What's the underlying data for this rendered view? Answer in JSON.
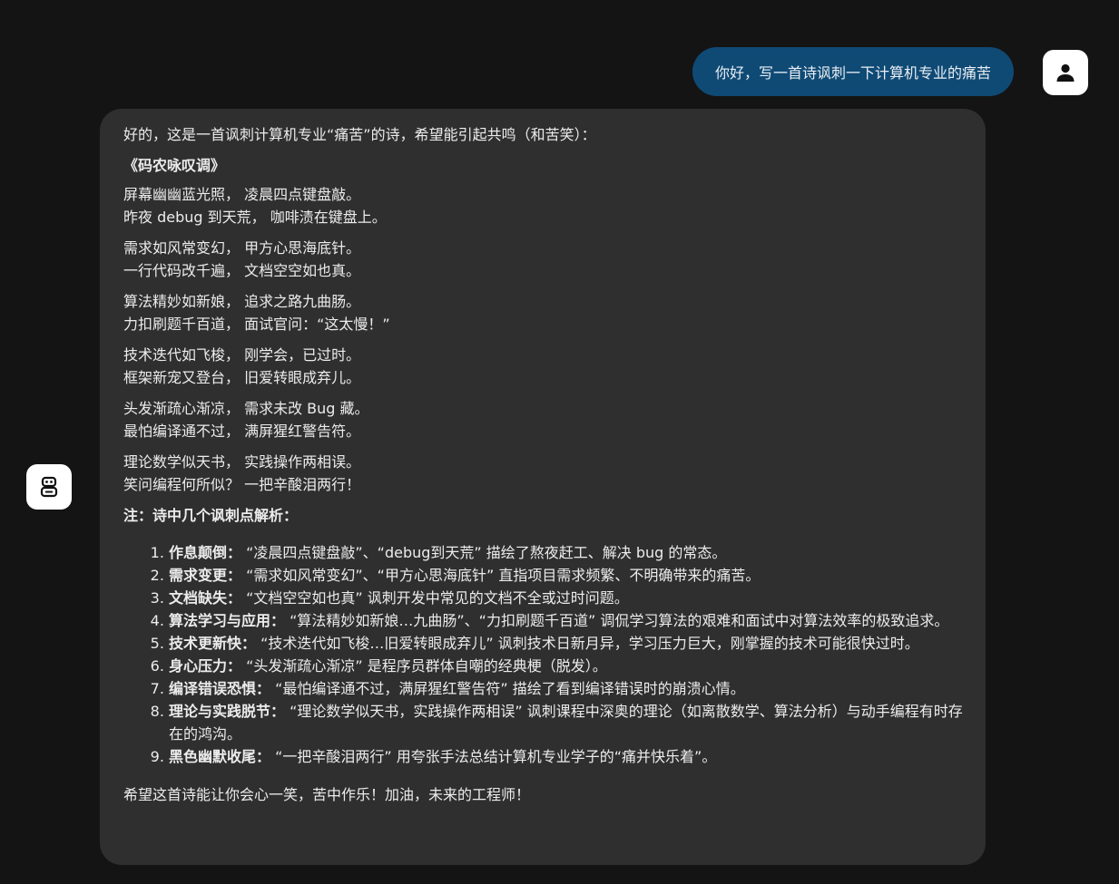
{
  "user_message": {
    "text": "你好，写一首诗讽刺一下计算机专业的痛苦",
    "avatar_icon": "user-icon"
  },
  "assistant": {
    "avatar_icon": "robot-icon",
    "intro": "好的，这是一首讽刺计算机专业“痛苦”的诗，希望能引起共鸣（和苦笑）：",
    "poem_title": "《码农咏叹调》",
    "stanzas": [
      [
        "屏幕幽幽蓝光照， 凌晨四点键盘敲。",
        "昨夜 debug 到天荒， 咖啡渍在键盘上。"
      ],
      [
        "需求如风常变幻， 甲方心思海底针。",
        "一行代码改千遍， 文档空空如也真。"
      ],
      [
        "算法精妙如新娘， 追求之路九曲肠。",
        "力扣刷题千百道， 面试官问：“这太慢！”"
      ],
      [
        "技术迭代如飞梭， 刚学会，已过时。",
        "框架新宠又登台， 旧爱转眼成弃儿。"
      ],
      [
        "头发渐疏心渐凉， 需求未改 Bug 藏。",
        "最怕编译通不过， 满屏猩红警告符。"
      ],
      [
        "理论数学似天书， 实践操作两相误。",
        "笑问编程何所似？ 一把辛酸泪两行！"
      ]
    ],
    "note_title": "注：诗中几个讽刺点解析：",
    "notes": [
      {
        "label": "作息颠倒：",
        "text": " “凌晨四点键盘敲”、“debug到天荒” 描绘了熬夜赶工、解决 bug 的常态。"
      },
      {
        "label": "需求变更：",
        "text": " “需求如风常变幻”、“甲方心思海底针” 直指项目需求频繁、不明确带来的痛苦。"
      },
      {
        "label": "文档缺失：",
        "text": " “文档空空如也真” 讽刺开发中常见的文档不全或过时问题。"
      },
      {
        "label": "算法学习与应用：",
        "text": " “算法精妙如新娘…九曲肠”、“力扣刷题千百道” 调侃学习算法的艰难和面试中对算法效率的极致追求。"
      },
      {
        "label": "技术更新快：",
        "text": " “技术迭代如飞梭…旧爱转眼成弃儿” 讽刺技术日新月异，学习压力巨大，刚掌握的技术可能很快过时。"
      },
      {
        "label": "身心压力：",
        "text": " “头发渐疏心渐凉” 是程序员群体自嘲的经典梗（脱发）。"
      },
      {
        "label": "编译错误恐惧：",
        "text": " “最怕编译通不过，满屏猩红警告符” 描绘了看到编译错误时的崩溃心情。"
      },
      {
        "label": "理论与实践脱节：",
        "text": " “理论数学似天书，实践操作两相误” 讽刺课程中深奥的理论（如离散数学、算法分析）与动手编程有时存在的鸿沟。"
      },
      {
        "label": "黑色幽默收尾：",
        "text": " “一把辛酸泪两行” 用夸张手法总结计算机专业学子的“痛并快乐着”。"
      }
    ],
    "closing": "希望这首诗能让你会心一笑，苦中作乐！加油，未来的工程师！"
  }
}
